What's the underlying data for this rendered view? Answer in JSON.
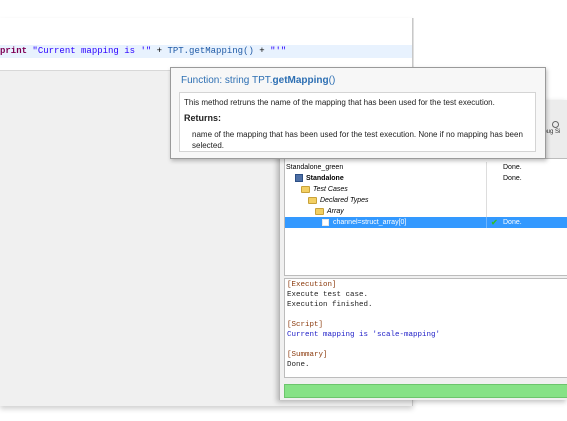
{
  "editor": {
    "code": {
      "keyword": "print",
      "string1": "\"Current mapping is '\"",
      "plus1": " + ",
      "call": "TPT.getMapping()",
      "plus2": " + ",
      "string2": "\"'\""
    }
  },
  "tooltip": {
    "signature_prefix": "Function: string TPT.",
    "signature_name": "getMapping",
    "signature_suffix": "()",
    "description": "This method retruns the name of the mapping that has been used for the test execution.",
    "returns_heading": "Returns:",
    "returns_text": "name of the mapping that has been used for the test execution. None if no mapping has been selected."
  },
  "runner": {
    "debug_label": "ebug Si",
    "tree": [
      {
        "label": "Standalone_green",
        "status": "Done.",
        "style": "plain",
        "icon": "none"
      },
      {
        "label": "Standalone",
        "status": "Done.",
        "style": "bold",
        "icon": "standalone-icon"
      },
      {
        "label": "Test Cases",
        "status": "",
        "style": "italic",
        "icon": "folder-icon"
      },
      {
        "label": "Declared Types",
        "status": "",
        "style": "italic",
        "icon": "folder-icon"
      },
      {
        "label": "Array",
        "status": "",
        "style": "italic",
        "icon": "folder-icon"
      },
      {
        "label": "channel=struct_array[0]",
        "status": "Done.",
        "style": "selected",
        "icon": "channel-icon"
      }
    ],
    "log": [
      {
        "text": "[Execution]",
        "kind": "head"
      },
      {
        "text": "Execute test case.",
        "kind": "plain"
      },
      {
        "text": "Execution finished.",
        "kind": "plain"
      },
      {
        "text": "",
        "kind": "plain"
      },
      {
        "text": "[Script]",
        "kind": "head"
      },
      {
        "text": "Current mapping is 'scale-mapping'",
        "kind": "blue"
      },
      {
        "text": "",
        "kind": "plain"
      },
      {
        "text": "[Summary]",
        "kind": "head"
      },
      {
        "text": "Done.",
        "kind": "plain"
      }
    ],
    "progress": 1.0
  },
  "colors": {
    "selection": "#3399ff",
    "progress": "#86e286",
    "tooltip_title": "#2d6fb3",
    "keyword": "#7f0055",
    "string": "#2a00ff"
  }
}
